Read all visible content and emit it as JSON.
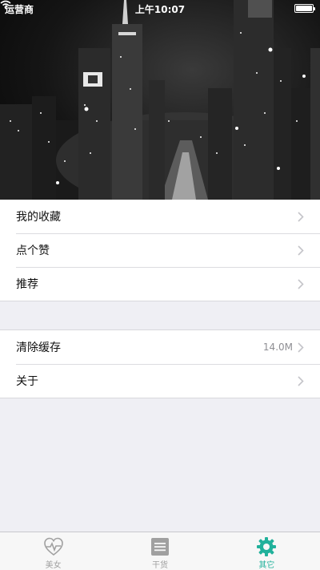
{
  "status_bar": {
    "carrier": "运营商",
    "time": "上午10:07"
  },
  "menu_group_1": {
    "items": [
      {
        "label": "我的收藏",
        "icon": "chevron-right-icon"
      },
      {
        "label": "点个赞",
        "icon": "chevron-right-icon"
      },
      {
        "label": "推荐",
        "icon": "chevron-right-icon"
      }
    ]
  },
  "menu_group_2": {
    "items": [
      {
        "label": "清除缓存",
        "detail": "14.0M",
        "icon": "chevron-right-icon"
      },
      {
        "label": "关于",
        "icon": "chevron-right-icon"
      }
    ]
  },
  "tab_bar": {
    "tabs": [
      {
        "label": "美女",
        "icon": "heart-pulse-icon",
        "active": false
      },
      {
        "label": "干货",
        "icon": "list-icon",
        "active": false
      },
      {
        "label": "其它",
        "icon": "gear-icon",
        "active": true
      }
    ]
  },
  "colors": {
    "accent": "#21b19b",
    "tab_inactive": "#a0a0a0",
    "background": "#efeff4"
  }
}
